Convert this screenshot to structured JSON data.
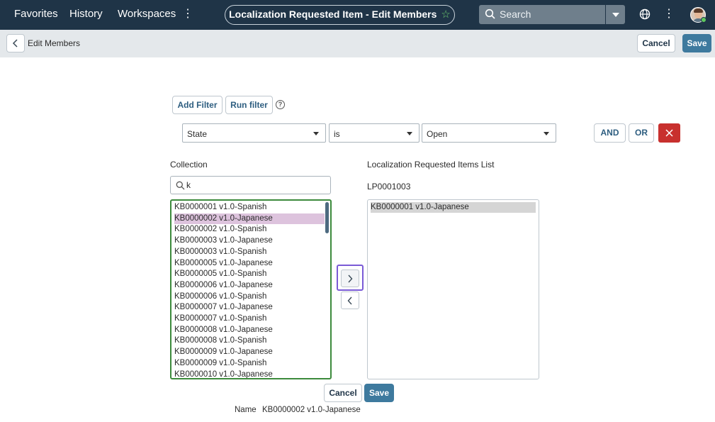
{
  "topnav": {
    "favorites": "Favorites",
    "history": "History",
    "workspaces": "Workspaces",
    "title": "Localization Requested Item - Edit Members",
    "search_placeholder": "Search"
  },
  "subheader": {
    "title": "Edit Members",
    "cancel_label": "Cancel",
    "save_label": "Save"
  },
  "filter": {
    "add_filter_label": "Add Filter",
    "run_filter_label": "Run filter",
    "field": "State",
    "operator": "is",
    "value": "Open",
    "and_label": "AND",
    "or_label": "OR"
  },
  "collection": {
    "label": "Collection",
    "search_value": "k",
    "items": [
      "KB0000001 v1.0-Spanish",
      "KB0000002 v1.0-Japanese",
      "KB0000002 v1.0-Spanish",
      "KB0000003 v1.0-Japanese",
      "KB0000003 v1.0-Spanish",
      "KB0000005 v1.0-Japanese",
      "KB0000005 v1.0-Spanish",
      "KB0000006 v1.0-Japanese",
      "KB0000006 v1.0-Spanish",
      "KB0000007 v1.0-Japanese",
      "KB0000007 v1.0-Spanish",
      "KB0000008 v1.0-Japanese",
      "KB0000008 v1.0-Spanish",
      "KB0000009 v1.0-Japanese",
      "KB0000009 v1.0-Spanish",
      "KB0000010 v1.0-Japanese"
    ],
    "selected_index": 1
  },
  "members": {
    "label": "Localization Requested Items List",
    "record": "LP0001003",
    "items": [
      "KB0000001 v1.0-Japanese"
    ]
  },
  "bottom": {
    "cancel_label": "Cancel",
    "save_label": "Save",
    "name_label": "Name",
    "name_value": "KB0000002 v1.0-Japanese"
  },
  "colors": {
    "nav_bg": "#1f3447",
    "primary": "#3e7a9e",
    "danger": "#c8302e",
    "list_border": "#3c8a3c",
    "focus": "#7a5bd6",
    "selected_row": "#ddc3dd"
  },
  "icons": [
    "more-vertical-icon",
    "star-icon",
    "search-icon",
    "chevron-down-icon",
    "globe-icon",
    "avatar",
    "chevron-left-icon",
    "help-icon",
    "close-icon",
    "chevron-right-icon"
  ]
}
